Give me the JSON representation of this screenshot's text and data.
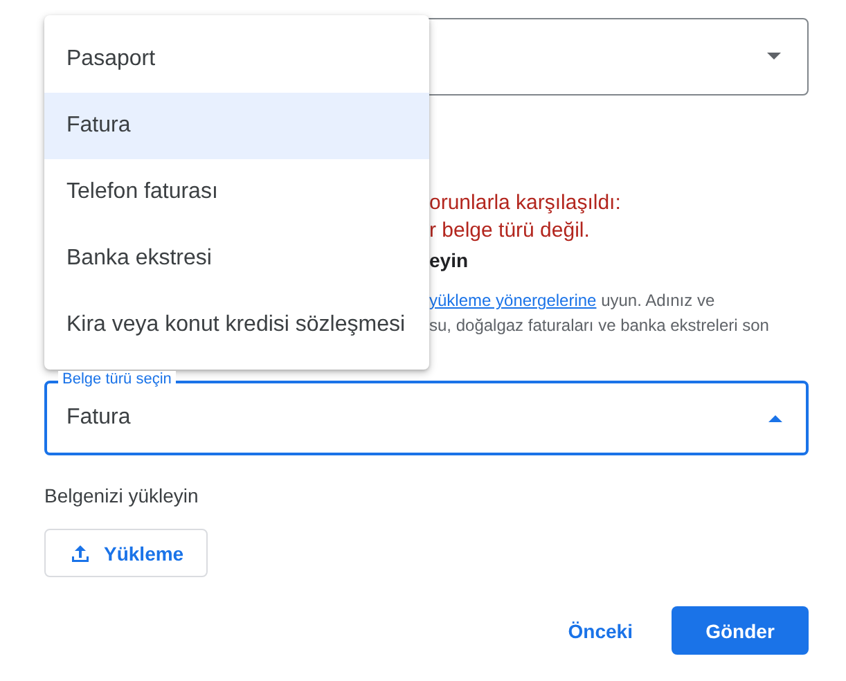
{
  "first_select": {
    "expanded": false
  },
  "error": {
    "lines": [
      "orunlarla karşılaşıldı:",
      "r belge türü değil."
    ]
  },
  "section_heading": "eyin",
  "help": {
    "link": "yükleme yönergelerine",
    "after_link": " uyun. Adınız ve",
    "line_2": "su, doğalgaz faturaları ve banka ekstreleri son"
  },
  "document_type_select": {
    "label": "Belge türü seçin",
    "value": "Fatura",
    "expanded": true
  },
  "menu": {
    "items": [
      {
        "label": "Pasaport",
        "selected": false
      },
      {
        "label": "Fatura",
        "selected": true
      },
      {
        "label": "Telefon faturası",
        "selected": false
      },
      {
        "label": "Banka ekstresi",
        "selected": false
      },
      {
        "label": "Kira veya konut kredisi sözleşmesi",
        "selected": false
      }
    ]
  },
  "upload": {
    "heading": "Belgenizi yükleyin",
    "button": "Yükleme"
  },
  "actions": {
    "back": "Önceki",
    "submit": "Gönder"
  }
}
